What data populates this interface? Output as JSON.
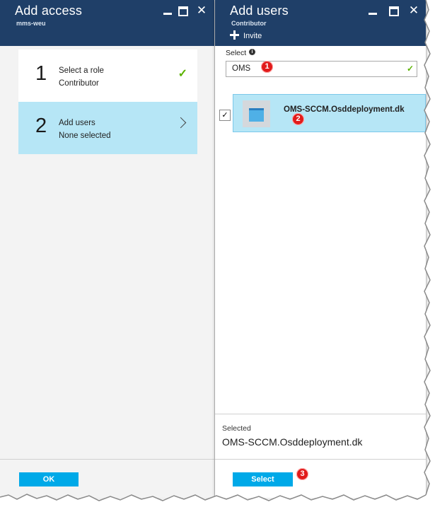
{
  "left_blade": {
    "title": "Add access",
    "subtitle": "mms-weu",
    "steps": [
      {
        "number": "1",
        "title": "Select a role",
        "value": "Contributor"
      },
      {
        "number": "2",
        "title": "Add users",
        "value": "None selected"
      }
    ],
    "ok_label": "OK"
  },
  "right_blade": {
    "title": "Add users",
    "subtitle": "Contributor",
    "invite_label": "Invite",
    "select_label": "Select",
    "search_value": "OMS",
    "results": [
      {
        "name": "OMS-SCCM.Osddeployment.dk",
        "checked": true
      }
    ],
    "selected_label": "Selected",
    "selected_value": "OMS-SCCM.Osddeployment.dk",
    "select_button_label": "Select"
  },
  "markers": [
    "1",
    "2",
    "3"
  ],
  "icons": {
    "step_done": "checkmark-icon",
    "step_next": "chevron-right-icon",
    "invite": "plus-icon",
    "info": "info-icon",
    "result": "app-icon"
  },
  "colors": {
    "header": "#1f3f68",
    "accent_button": "#00a9e8",
    "selection": "#b6e6f6",
    "check_green": "#5bb300",
    "marker_red": "#e11b1b"
  }
}
